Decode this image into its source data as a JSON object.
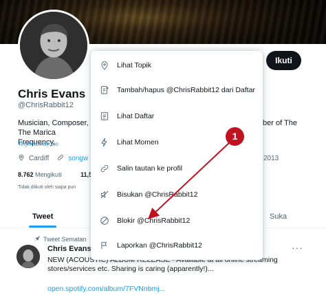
{
  "profile": {
    "name": "Chris Evans",
    "handle": "@ChrisRabbit12",
    "follow_label": "Ikuti",
    "bio_line1": "Musician, Composer, I",
    "bio_line2": "The Marica Frequency.",
    "bio_right": "ber of The",
    "translate_label": "Terjemahkan bio",
    "location": "Cardiff",
    "link": "songw",
    "joined": "2013",
    "following_count": "8.762",
    "following_label": "Mengikuti",
    "followers_partial": "11,5",
    "not_followed_text": "Tidak diikuti oleh siapa pun"
  },
  "tabs": {
    "tweet": "Tweet",
    "likes": "Suka"
  },
  "tweet": {
    "pinned_label": "Tweet Sematan",
    "author": "Chris Evans @",
    "more": "···",
    "text": "NEW (ACOUSTIC) ALBUM RELEASE - Available at all online streaming stores/services etc. Sharing is caring (apparently!)...",
    "link": "open.spotify.com/album/7FVNnbmj..."
  },
  "menu": {
    "items": [
      {
        "label": "Lihat Topik",
        "icon": "topic-icon"
      },
      {
        "label": "Tambah/hapus @ChrisRabbit12 dari Daftar",
        "icon": "list-add-icon"
      },
      {
        "label": "Lihat Daftar",
        "icon": "list-icon"
      },
      {
        "label": "Lihat Momen",
        "icon": "lightning-icon"
      },
      {
        "label": "Salin tautan ke profil",
        "icon": "link-icon"
      },
      {
        "label": "Bisukan @ChrisRabbit12",
        "icon": "mute-icon"
      },
      {
        "label": "Blokir @ChrisRabbit12",
        "icon": "block-icon"
      },
      {
        "label": "Laporkan @ChrisRabbit12",
        "icon": "flag-icon"
      }
    ]
  },
  "annotation": {
    "badge_number": "1",
    "color": "#c1121f"
  }
}
